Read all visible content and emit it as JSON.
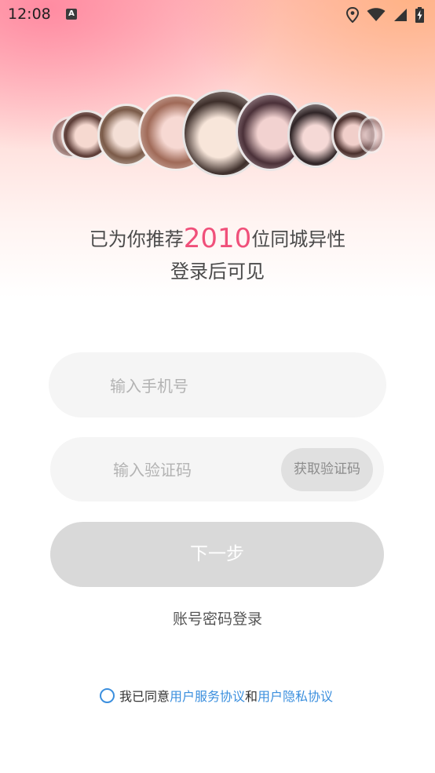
{
  "status_bar": {
    "time": "12:08",
    "a_icon_label": "A",
    "icons": [
      "location-icon",
      "wifi-icon",
      "signal-icon",
      "battery-charging-icon"
    ]
  },
  "hero": {
    "headline_prefix": "已为你推荐",
    "count": "2010",
    "headline_suffix": "位同城异性",
    "subline": "登录后可见",
    "accent_color": "#f0507a"
  },
  "form": {
    "phone_placeholder": "输入手机号",
    "code_placeholder": "输入验证码",
    "get_code_label": "获取验证码",
    "next_label": "下一步",
    "password_login_label": "账号密码登录"
  },
  "agreement": {
    "prefix": "我已同意",
    "service_link": "用户服务协议",
    "and": "和",
    "privacy_link": "用户隐私协议",
    "link_color": "#3b8fde"
  }
}
